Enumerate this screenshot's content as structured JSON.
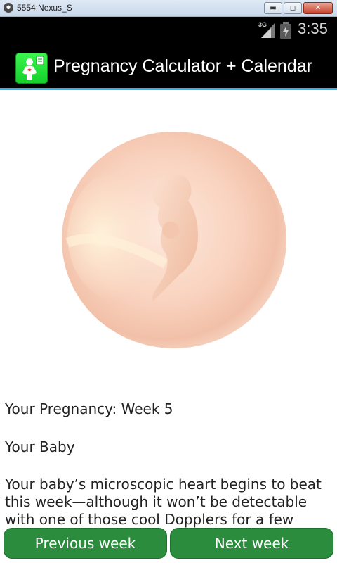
{
  "window": {
    "title": "5554:Nexus_S",
    "minimize_label": "▬",
    "maximize_label": "◻",
    "close_label": "✕"
  },
  "status_bar": {
    "network": "3G",
    "time": "3:35",
    "icons": [
      "signal-icon",
      "battery-icon"
    ]
  },
  "action_bar": {
    "title": "Pregnancy Calculator + Calendar",
    "icon": "pregnancy-app-icon"
  },
  "content": {
    "image": "embryo-illustration",
    "heading": "Your Pregnancy: Week 5",
    "section_title": "Your Baby",
    "body_lines": [
      "Your baby’s microscopic heart begins to beat",
      "this week—although it won’t be detectable",
      "with one of those cool Dopplers for a few"
    ]
  },
  "buttons": {
    "previous": "Previous week",
    "next": "Next week"
  },
  "colors": {
    "action_bar_accent": "#33b5e5",
    "button_green": "#2a8c3c",
    "app_icon_green": "#22e03a"
  }
}
